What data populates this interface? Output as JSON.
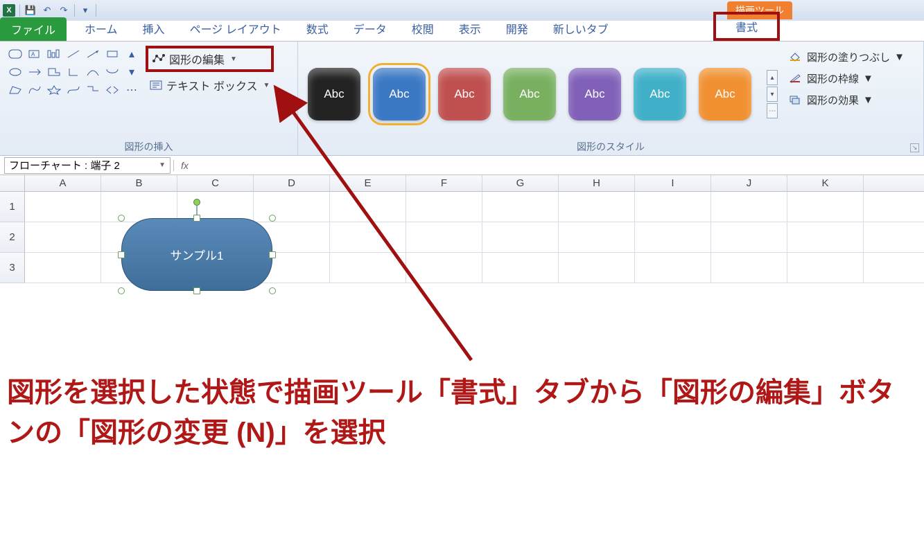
{
  "qat": {
    "save": "💾",
    "undo": "↶",
    "redo": "↷"
  },
  "drawing_tools_tag": "描画ツール",
  "tabs": {
    "file": "ファイル",
    "home": "ホーム",
    "insert": "挿入",
    "page_layout": "ページ レイアウト",
    "formulas": "数式",
    "data": "データ",
    "review": "校閲",
    "view": "表示",
    "developer": "開発",
    "new_tab": "新しいタブ",
    "format": "書式"
  },
  "ribbon": {
    "insert_shapes_label": "図形の挿入",
    "edit_shape": "図形の編集",
    "text_box": "テキスト ボックス",
    "shape_styles_label": "図形のスタイル",
    "style_sample": "Abc",
    "styles": [
      {
        "bg": "#222222"
      },
      {
        "bg": "#3b78c4",
        "selected": true
      },
      {
        "bg": "#c05050"
      },
      {
        "bg": "#78b060"
      },
      {
        "bg": "#8060b8"
      },
      {
        "bg": "#40b0c8"
      },
      {
        "bg": "#f09030"
      }
    ],
    "fill": "図形の塗りつぶし",
    "outline": "図形の枠線",
    "effects": "図形の効果"
  },
  "name_box": "フローチャート : 端子 2",
  "fx": "fx",
  "columns": [
    "A",
    "B",
    "C",
    "D",
    "E",
    "F",
    "G",
    "H",
    "I",
    "J",
    "K"
  ],
  "rows": [
    "1",
    "2",
    "3"
  ],
  "shape_text": "サンプル1",
  "instruction": "図形を選択した状態で描画ツール「書式」タブから「図形の編集」ボタンの「図形の変更 (N)」を選択"
}
